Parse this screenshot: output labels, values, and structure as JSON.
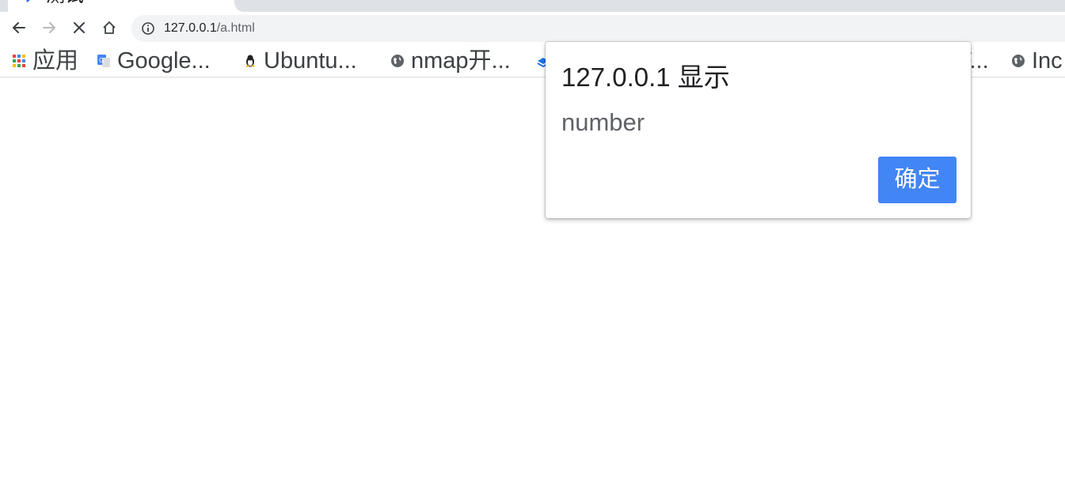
{
  "tab": {
    "title": "测试",
    "favicon": "arrow-favicon"
  },
  "toolbar": {
    "back_icon": "back-arrow-icon",
    "forward_icon": "forward-arrow-icon",
    "stop_icon": "stop-icon",
    "home_icon": "home-icon",
    "info_icon": "info-icon"
  },
  "omnibox": {
    "url_host": "127.0.0.1",
    "url_path": "/a.html"
  },
  "bookmarks": {
    "apps_label": "应用",
    "items": [
      {
        "label": "Google...",
        "icon": "google-translate-icon"
      },
      {
        "label": "Ubuntu...",
        "icon": "penguin-icon"
      },
      {
        "label": "nmap开...",
        "icon": "globe-icon"
      },
      {
        "label": "F...",
        "icon": "globe-icon"
      },
      {
        "label": "Inc",
        "icon": "globe-icon"
      }
    ]
  },
  "dialog": {
    "title": "127.0.0.1 显示",
    "message": "number",
    "ok_label": "确定"
  },
  "colors": {
    "accent": "#4285f4",
    "omnibox_bg": "#f1f3f4",
    "tabstrip_bg": "#dee1e6"
  }
}
